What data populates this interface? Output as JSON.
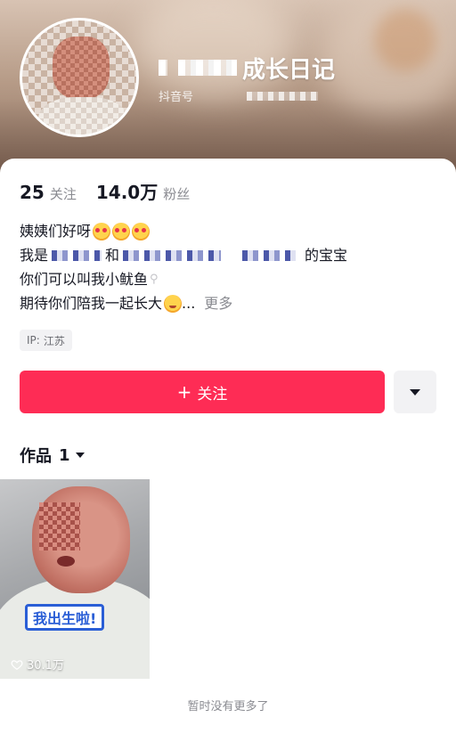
{
  "profile": {
    "nickname": "成长日记",
    "douyin_id_label": "抖音号"
  },
  "stats": {
    "following_count": "25",
    "following_label": "关注",
    "followers_count": "14.0万",
    "followers_label": "粉丝"
  },
  "bio": {
    "line1": "姨姨们好呀",
    "line2_prefix": "我是",
    "line2_mid": "和",
    "line2_suffix": "的宝宝",
    "line3": "你们可以叫我小鱿鱼",
    "line4": "期待你们陪我一起长大",
    "line4_ellipsis": "...",
    "more_label": "更多"
  },
  "ip_tag": {
    "label": "IP:",
    "location": "江苏"
  },
  "actions": {
    "follow_label": "关注",
    "follow_plus": "+"
  },
  "works_tab": {
    "label": "作品",
    "count": "1"
  },
  "video": {
    "caption": "我出生啦!",
    "likes": "30.1万"
  },
  "footer": {
    "no_more_text": "暂时没有更多了"
  },
  "icons": {
    "heart": "heart-icon",
    "dropdown": "triangle-down-icon",
    "search": "search-icon"
  },
  "colors": {
    "accent": "#fe2c55",
    "secondary_text": "#8a8b91"
  }
}
